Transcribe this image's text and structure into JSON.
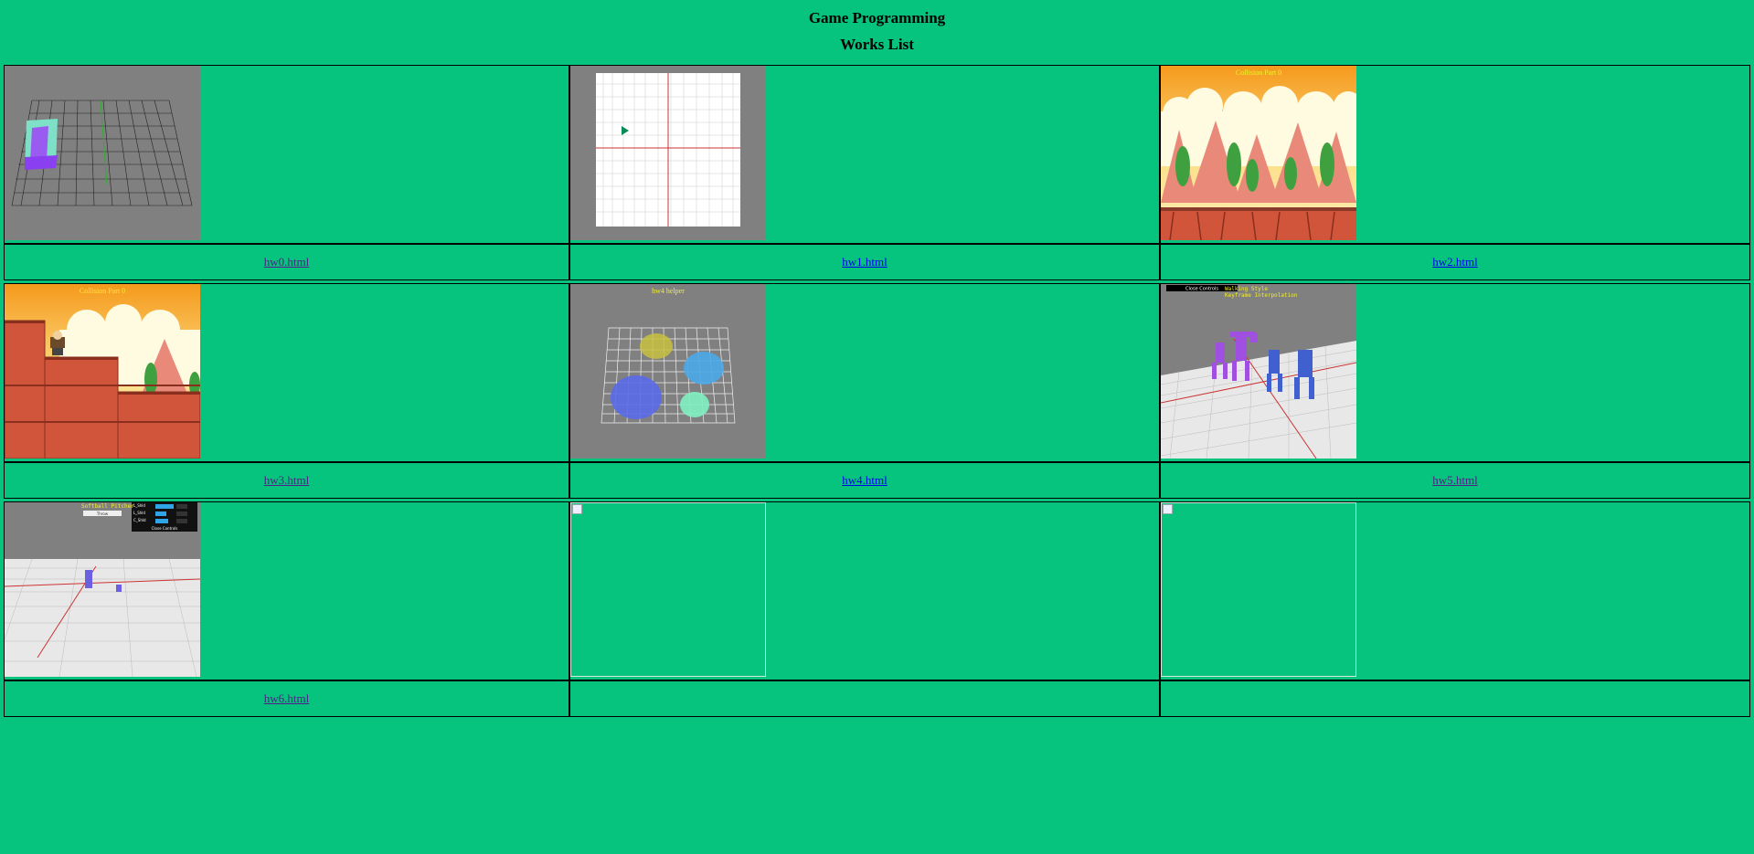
{
  "page": {
    "title": "Game Programming",
    "subtitle": "Works List"
  },
  "works": [
    {
      "link": "hw0.html",
      "visited": true,
      "overlay": ""
    },
    {
      "link": "hw1.html",
      "visited": false,
      "overlay": ""
    },
    {
      "link": "hw2.html",
      "visited": false,
      "overlay": "Collision Part 0"
    },
    {
      "link": "hw3.html",
      "visited": true,
      "overlay": "Collision Part 0"
    },
    {
      "link": "hw4.html",
      "visited": false,
      "overlay": "hw4 helper"
    },
    {
      "link": "hw5.html",
      "visited": true,
      "overlay": "Walking Style\nKeyframe Interpolation",
      "button": "Close Controls"
    },
    {
      "link": "hw6.html",
      "visited": true,
      "overlay": "Softball Pitcher",
      "button": "Close Controls",
      "sliders": [
        "L_Shld",
        "L_Shld",
        "C_Shld"
      ],
      "overlay2": "Throw"
    },
    {
      "link": "",
      "visited": false,
      "overlay": ""
    },
    {
      "link": "",
      "visited": false,
      "overlay": ""
    }
  ],
  "colors": {
    "background": "#06c37d",
    "link": "#0000ee",
    "visited": "#551a8b"
  }
}
